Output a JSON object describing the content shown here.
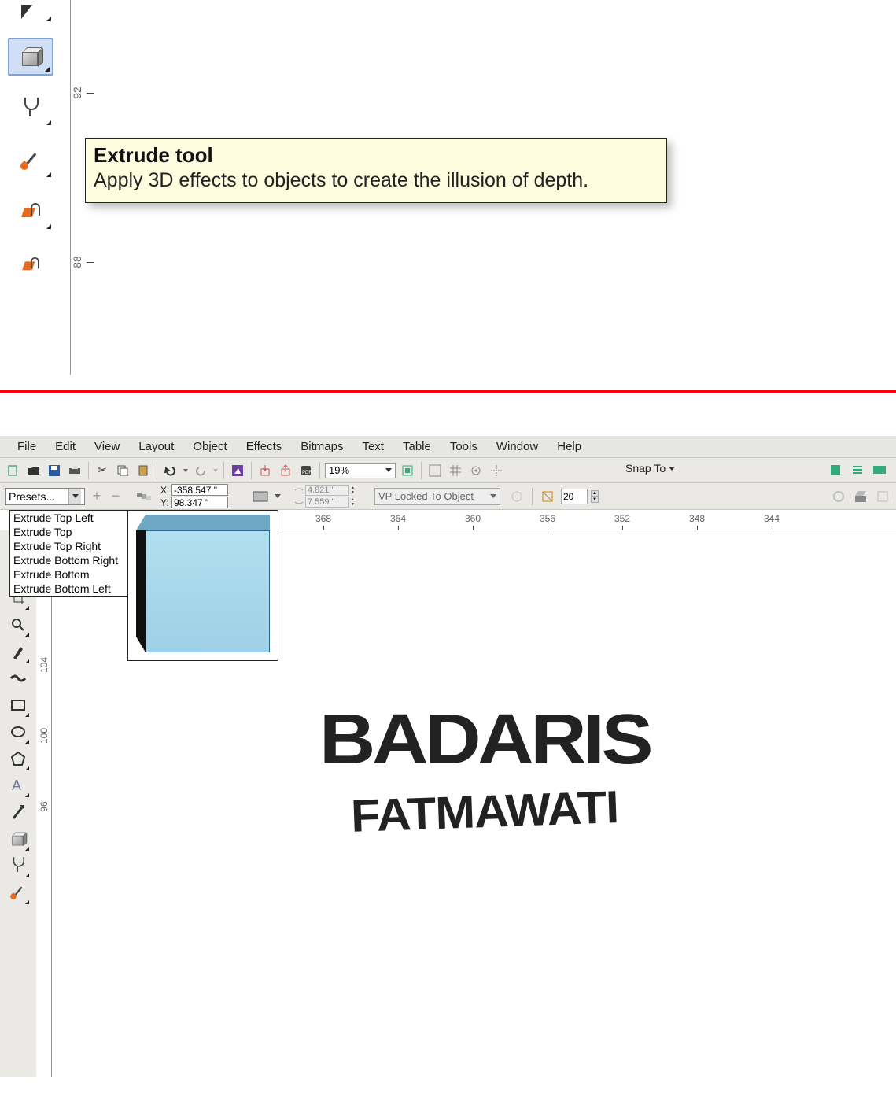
{
  "top": {
    "ruler_ticks": [
      "92",
      "88"
    ],
    "tooltip": {
      "title": "Extrude tool",
      "desc": "Apply 3D effects to objects to create the illusion of depth."
    }
  },
  "menu": [
    "File",
    "Edit",
    "View",
    "Layout",
    "Object",
    "Effects",
    "Bitmaps",
    "Text",
    "Table",
    "Tools",
    "Window",
    "Help"
  ],
  "toolbar1": {
    "zoom": "19%",
    "snapto": "Snap To"
  },
  "propbar": {
    "presets_label": "Presets...",
    "x_label": "X:",
    "y_label": "Y:",
    "x_val": "-358.547 \"",
    "y_val": "98.347 \"",
    "w_val": "4.821 \"",
    "h_val": "7.559 \"",
    "vp_lock": "VP Locked To Object",
    "depth_val": "20"
  },
  "presets_dropdown": [
    "Extrude Top Left",
    "Extrude Top",
    "Extrude Top Right",
    "Extrude Bottom Right",
    "Extrude Bottom",
    "Extrude Bottom Left"
  ],
  "ruler_h": [
    "368",
    "364",
    "360",
    "356",
    "352",
    "348",
    "344"
  ],
  "ruler_v_main": [
    "104",
    "100",
    "96"
  ],
  "canvas_text": {
    "line1": "BADARIS",
    "line2": "FATMAWATI"
  }
}
